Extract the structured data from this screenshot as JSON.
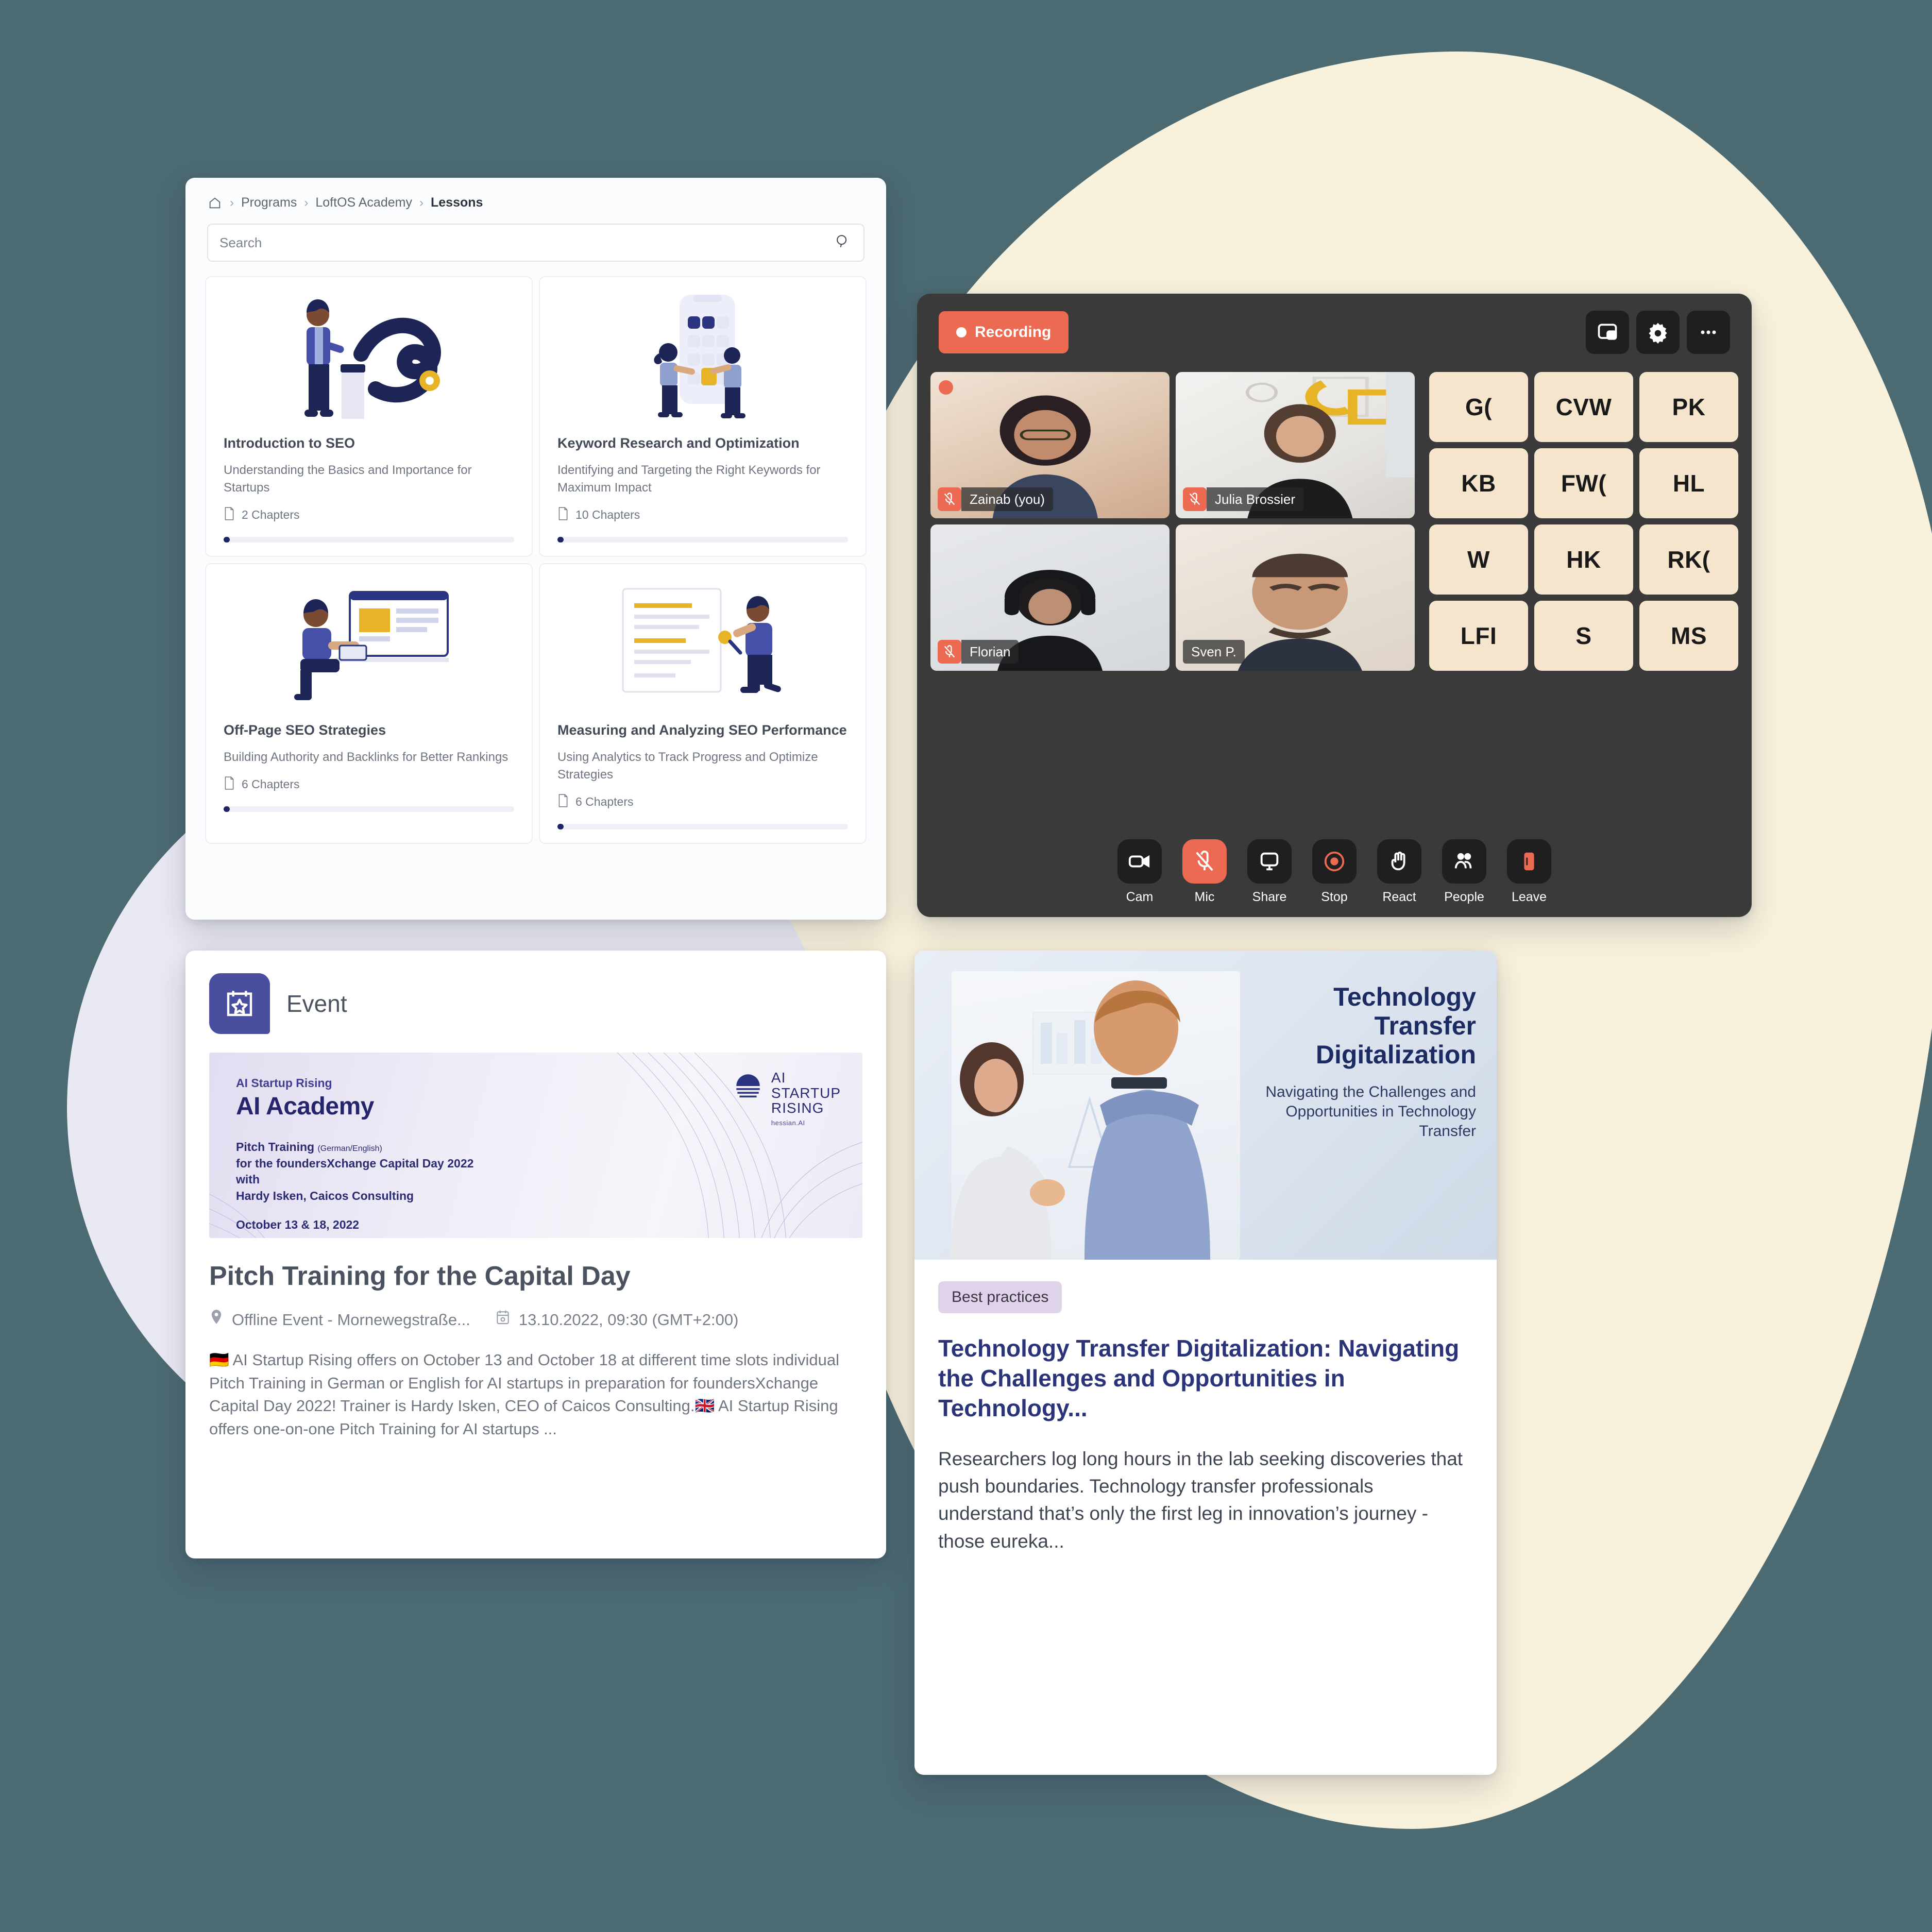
{
  "background": {
    "base_color": "#4c6a72",
    "cream_blob": "#f8f1dc",
    "lavender_blob": "#e9e9f3"
  },
  "lessons_panel": {
    "breadcrumb": {
      "home_icon": "home-icon",
      "items": [
        "Programs",
        "LoftOS Academy",
        "Lessons"
      ],
      "separator": "›"
    },
    "search": {
      "placeholder": "Search",
      "icon": "search-icon"
    },
    "cards": [
      {
        "title": "Introduction to SEO",
        "subtitle": "Understanding the Basics and Importance for Startups",
        "chapters": "2 Chapters",
        "chapter_icon": "document-icon",
        "progress_percent": 1
      },
      {
        "title": "Keyword Research and Optimization",
        "subtitle": "Identifying and Targeting the Right Keywords for Maximum Impact",
        "chapters": "10 Chapters",
        "chapter_icon": "document-icon",
        "progress_percent": 1
      },
      {
        "title": "Off-Page SEO Strategies",
        "subtitle": "Building Authority and Backlinks for Better Rankings",
        "chapters": "6 Chapters",
        "chapter_icon": "document-icon",
        "progress_percent": 1
      },
      {
        "title": "Measuring and Analyzing SEO Performance",
        "subtitle": "Using Analytics to Track Progress and Optimize Strategies",
        "chapters": "6 Chapters",
        "chapter_icon": "document-icon",
        "progress_percent": 1
      }
    ]
  },
  "video_panel": {
    "recording_badge": {
      "label": "Recording",
      "color": "#ec6a52"
    },
    "top_icons": [
      {
        "name": "picture-in-picture-icon"
      },
      {
        "name": "gear-icon"
      },
      {
        "name": "more-options-icon"
      }
    ],
    "participants": [
      {
        "name": "Zainab (you)",
        "muted": true,
        "recording_dot": true
      },
      {
        "name": "Julia Brossier",
        "muted": true,
        "recording_dot": false
      },
      {
        "name": "Florian",
        "muted": true,
        "recording_dot": false
      },
      {
        "name": "Sven P.",
        "muted": false,
        "recording_dot": false
      }
    ],
    "avatar_initials": [
      "G(",
      "CVW",
      "PK",
      "KB",
      "FW(",
      "HL",
      "W",
      "HK",
      "RK(",
      "LFI",
      "S",
      "MS"
    ],
    "avatar_color": "#f5e5cd",
    "controls": [
      {
        "label": "Cam",
        "icon": "camera-icon",
        "active": false
      },
      {
        "label": "Mic",
        "icon": "mic-off-icon",
        "active": true
      },
      {
        "label": "Share",
        "icon": "screen-share-icon",
        "active": false
      },
      {
        "label": "Stop",
        "icon": "stop-record-icon",
        "active": false
      },
      {
        "label": "React",
        "icon": "raise-hand-icon",
        "active": false
      },
      {
        "label": "People",
        "icon": "people-icon",
        "active": false
      },
      {
        "label": "Leave",
        "icon": "leave-door-icon",
        "active": false
      }
    ]
  },
  "event_panel": {
    "kicker": "Event",
    "kicker_icon": "calendar-star-icon",
    "banner": {
      "kicker": "AI Startup Rising",
      "title": "AI Academy",
      "line_main": "Pitch Training",
      "line_main_note": "(German/English)",
      "line2": "for the foundersXchange Capital Day 2022",
      "line3": "with",
      "line4": "Hardy Isken, Caicos Consulting",
      "date": "October 13 & 18, 2022",
      "logo_title": "AI\nSTARTUP\nRISING",
      "logo_sub": "hessian.AI"
    },
    "title": "Pitch Training for the Capital Day",
    "location_icon": "location-pin-icon",
    "location": "Offline Event - Mornewegstraße...",
    "date_icon": "calendar-icon",
    "date": "13.10.2022, 09:30 (GMT+2:00)",
    "description": "🇩🇪 AI Startup Rising offers on October 13 and October 18 at different time slots individual Pitch Training in German or English for AI startups in preparation for foundersXchange Capital Day 2022! Trainer is Hardy Isken, CEO of Caicos Consulting.🇬🇧 AI Startup Rising offers one-on-one Pitch Training for AI startups ..."
  },
  "article_panel": {
    "hero_title": "Technology Transfer Digitalization",
    "hero_subtitle": "Navigating the Challenges and Opportunities in Technology Transfer",
    "tag": "Best practices",
    "tag_color": "#dfd3e9",
    "title": "Technology Transfer Digitalization: Navigating the Challenges and Opportunities in Technology...",
    "excerpt": "Researchers log long hours in the lab seeking discoveries that push boundaries. Technology transfer professionals understand that’s only the first leg in innovation’s journey - those eureka..."
  }
}
